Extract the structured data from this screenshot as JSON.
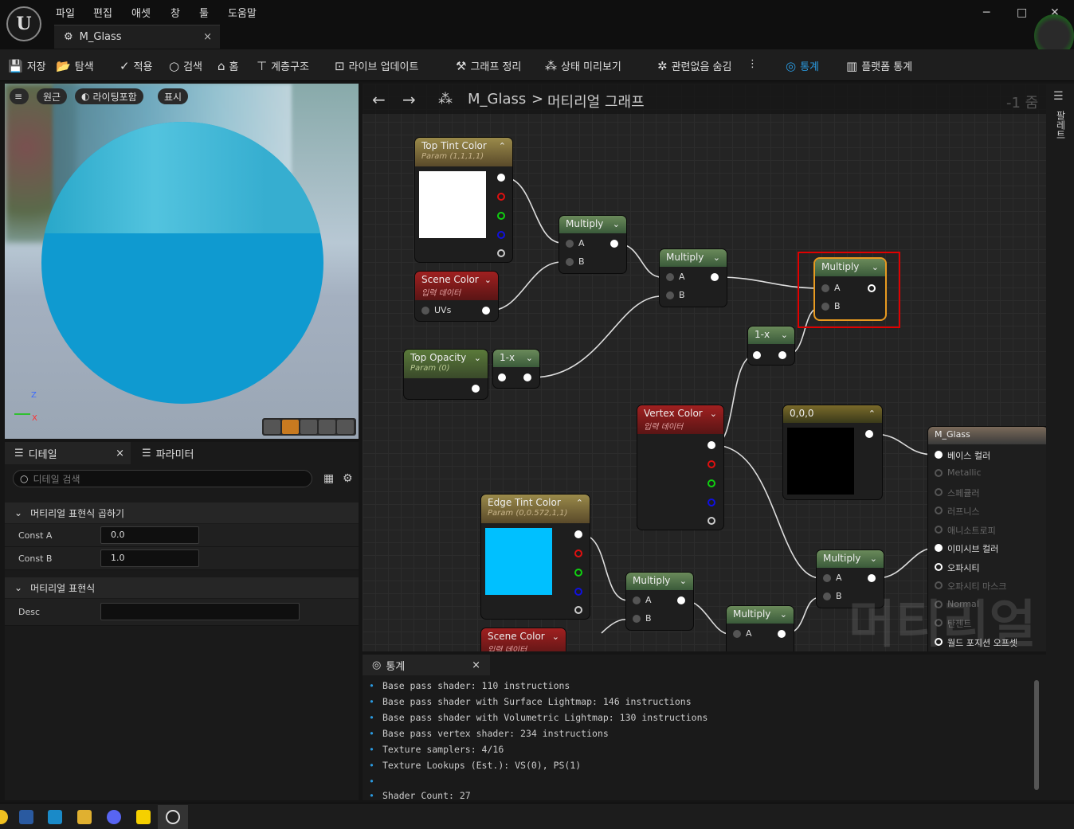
{
  "app": {
    "menu": [
      "파일",
      "편집",
      "애셋",
      "창",
      "툴",
      "도움말"
    ],
    "tab_title": "M_Glass",
    "tab_close": "×"
  },
  "window": {
    "minimize": "─",
    "maximize": "□",
    "close": "✕"
  },
  "toolbar": {
    "save": "저장",
    "browse": "탐색",
    "apply": "적용",
    "search": "검색",
    "home": "홈",
    "hierarchy": "계층구조",
    "live_update": "라이브 업데이트",
    "clean_graph": "그래프 정리",
    "state_preview": "상태 미리보기",
    "hide_unrelated": "관련없음 숨김",
    "stats": "통계",
    "platform_stats": "플랫폼 통계",
    "more": "⋮"
  },
  "viewport": {
    "perspective": "원근",
    "lighting": "라이팅포함",
    "show": "표시",
    "axis_z": "Z",
    "axis_x": "X"
  },
  "details": {
    "tab_details": "디테일",
    "tab_params": "파라미터",
    "close": "×",
    "search_placeholder": "디테일 검색",
    "section1": "머티리얼 표현식 곱하기",
    "const_a_label": "Const A",
    "const_a": "0.0",
    "const_b_label": "Const B",
    "const_b": "1.0",
    "section2": "머티리얼 표현식",
    "desc_label": "Desc",
    "desc": ""
  },
  "graph": {
    "breadcrumb_asset": "M_Glass",
    "breadcrumb_sep": ">",
    "breadcrumb_graph": "머티리얼 그래프",
    "zoom": "-1 줌",
    "palette": "팔레트",
    "watermark": "머티리얼",
    "nodes": {
      "top_tint": {
        "title": "Top Tint Color",
        "sub": "Param (1,1,1,1)"
      },
      "scene_color1": {
        "title": "Scene Color",
        "sub": "입력 데이터",
        "pin": "UVs"
      },
      "top_opacity": {
        "title": "Top Opacity",
        "sub": "Param (0)"
      },
      "oneminus1": {
        "title": "1-x"
      },
      "multiply1": {
        "title": "Multiply",
        "a": "A",
        "b": "B"
      },
      "multiply2": {
        "title": "Multiply",
        "a": "A",
        "b": "B"
      },
      "multiply_sel": {
        "title": "Multiply",
        "a": "A",
        "b": "B"
      },
      "oneminus2": {
        "title": "1-x"
      },
      "vertex_color": {
        "title": "Vertex Color",
        "sub": "입력 데이터"
      },
      "const000": {
        "title": "0,0,0"
      },
      "edge_tint": {
        "title": "Edge Tint Color",
        "sub": "Param (0,0.572,1,1)"
      },
      "scene_color2": {
        "title": "Scene Color",
        "sub": "입력 데이터"
      },
      "multiply3": {
        "title": "Multiply",
        "a": "A",
        "b": "B"
      },
      "multiply4": {
        "title": "Multiply",
        "a": "A",
        "b": "B"
      },
      "multiply5": {
        "title": "Multiply",
        "a": "A",
        "b": ""
      },
      "result": {
        "title": "M_Glass",
        "pins": [
          "베이스 컬러",
          "Metallic",
          "스페큘러",
          "러프니스",
          "애니소트로피",
          "이미시브 컬러",
          "오파시티",
          "오파시티 마스크",
          "Normal",
          "탄젠트",
          "월드 포지션 오프셋"
        ]
      }
    }
  },
  "stats": {
    "tab": "통계",
    "close": "×",
    "lines": [
      "Base pass shader: 110 instructions",
      "Base pass shader with Surface Lightmap: 146 instructions",
      "Base pass shader with Volumetric Lightmap: 130 instructions",
      "Base pass vertex shader: 234 instructions",
      "Texture samplers: 4/16",
      "Texture Lookups (Est.): VS(0), PS(1)",
      "",
      "Shader Count: 27"
    ]
  },
  "colors": {
    "accent": "#2a9ae0",
    "param_header": "#8a7a3a",
    "input_header": "#8a1f1f",
    "math_header": "#4a6a4a",
    "selection": "#e00000",
    "edge_tint": "#00c0ff"
  }
}
